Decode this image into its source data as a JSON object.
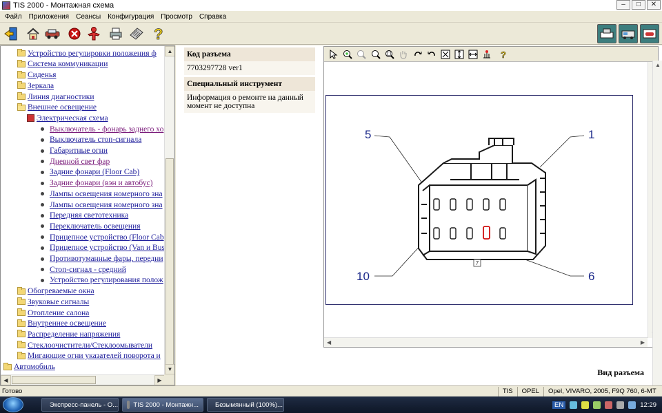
{
  "window": {
    "title": "TIS 2000 - Монтажная схема"
  },
  "menu": [
    "Файл",
    "Приложения",
    "Сеансы",
    "Конфигурация",
    "Просмотр",
    "Справка"
  ],
  "tree": {
    "items": [
      {
        "label": "Устройство регулировки положения ф",
        "level": 1,
        "type": "folder",
        "visited": false
      },
      {
        "label": "Система коммуникации",
        "level": 1,
        "type": "folder",
        "visited": false
      },
      {
        "label": "Сиденья",
        "level": 1,
        "type": "folder",
        "visited": false
      },
      {
        "label": "Зеркала",
        "level": 1,
        "type": "folder",
        "visited": false
      },
      {
        "label": "Линия диагностики",
        "level": 1,
        "type": "folder",
        "visited": false
      },
      {
        "label": "Внешнее освещение",
        "level": 1,
        "type": "folder-open",
        "visited": false
      },
      {
        "label": "Электрическая схема",
        "level": 2,
        "type": "doc",
        "visited": false
      },
      {
        "label": "Выключатель - фонарь заднего хо",
        "level": 3,
        "type": "bullet",
        "visited": true
      },
      {
        "label": "Выключатель стоп-сигнала",
        "level": 3,
        "type": "bullet",
        "visited": false
      },
      {
        "label": "Габаритные огни",
        "level": 3,
        "type": "bullet",
        "visited": false
      },
      {
        "label": "Дневной свет фар",
        "level": 3,
        "type": "bullet",
        "visited": true
      },
      {
        "label": "Задние фонари (Floor Cab)",
        "level": 3,
        "type": "bullet",
        "visited": false
      },
      {
        "label": "Задние фонари (вэн и автобус)",
        "level": 3,
        "type": "bullet",
        "visited": true
      },
      {
        "label": "Лампы освещения номерного зна",
        "level": 3,
        "type": "bullet",
        "visited": false
      },
      {
        "label": "Лампы освещения номерного зна",
        "level": 3,
        "type": "bullet",
        "visited": false
      },
      {
        "label": "Передняя светотехника",
        "level": 3,
        "type": "bullet",
        "visited": false
      },
      {
        "label": "Переключатель освещения",
        "level": 3,
        "type": "bullet",
        "visited": false
      },
      {
        "label": "Прицепное устройство (Floor Cab",
        "level": 3,
        "type": "bullet",
        "visited": false
      },
      {
        "label": "Прицепное устройство (Van и Bus",
        "level": 3,
        "type": "bullet",
        "visited": false
      },
      {
        "label": "Противотуманные фары, передни",
        "level": 3,
        "type": "bullet",
        "visited": false
      },
      {
        "label": "Стоп-сигнал - средний",
        "level": 3,
        "type": "bullet",
        "visited": false
      },
      {
        "label": "Устройство регулирования полож",
        "level": 3,
        "type": "bullet",
        "visited": false
      },
      {
        "label": "Обогреваемые окна",
        "level": 1,
        "type": "folder",
        "visited": false
      },
      {
        "label": "Звуковые сигналы",
        "level": 1,
        "type": "folder",
        "visited": false
      },
      {
        "label": "Отопление салона",
        "level": 1,
        "type": "folder",
        "visited": false
      },
      {
        "label": "Внутреннее освещение",
        "level": 1,
        "type": "folder",
        "visited": false
      },
      {
        "label": "Распределение напряжения",
        "level": 1,
        "type": "folder",
        "visited": false
      },
      {
        "label": "Стеклоочистители/Стеклоомыватели",
        "level": 1,
        "type": "folder",
        "visited": false
      },
      {
        "label": "Мигающие огни указателей поворота и",
        "level": 1,
        "type": "folder",
        "visited": false
      },
      {
        "label": "Автомобиль",
        "level": 0,
        "type": "folder",
        "visited": false
      }
    ]
  },
  "info": {
    "connector_code_label": "Код разъема",
    "connector_code_value": "7703297728 ver1",
    "special_tool_label": "Специальный инструмент",
    "special_tool_value": "Информация о ремонте на данный момент не доступна"
  },
  "diagram": {
    "pin_labels": {
      "top_left": "5",
      "top_right": "1",
      "bottom_left": "10",
      "bottom_right": "6",
      "pin_marker": "7"
    },
    "highlight_color": "#d01010",
    "label_color": "#1c2a8a",
    "caption": "Вид разъема"
  },
  "status": {
    "left": "Готово",
    "mode": "TIS",
    "brand": "OPEL",
    "vehicle": "Opel, VIVARO, 2005, F9Q 760, 6-MT"
  },
  "taskbar": {
    "items": [
      "Экспресс-панель - О...",
      "TIS 2000 - Монтажн...",
      "Безымянный (100%)..."
    ],
    "lang": "EN",
    "clock": "12:29"
  }
}
